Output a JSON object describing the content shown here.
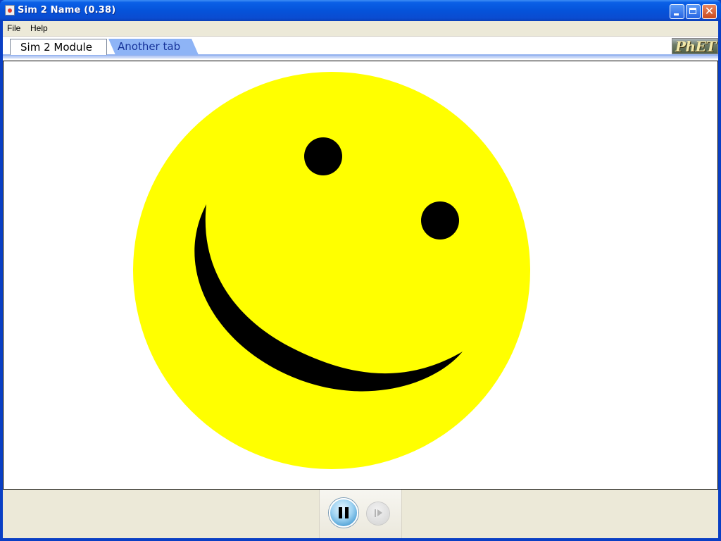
{
  "window": {
    "title": "Sim 2 Name (0.38)"
  },
  "menubar": {
    "items": [
      {
        "label": "File"
      },
      {
        "label": "Help"
      }
    ]
  },
  "tabs": {
    "items": [
      {
        "label": "Sim 2 Module",
        "active": true
      },
      {
        "label": "Another tab",
        "active": false
      }
    ],
    "logo_text": "PhET"
  },
  "canvas": {
    "face_color": "#ffff00",
    "feature_color": "#000000"
  },
  "clock_controls": {
    "pause_icon": "pause-icon",
    "step_icon": "step-icon",
    "step_enabled": false
  },
  "colors": {
    "titlebar": "#0553da",
    "inactive_tab": "#8eb4f6",
    "panel": "#ece9d8"
  }
}
